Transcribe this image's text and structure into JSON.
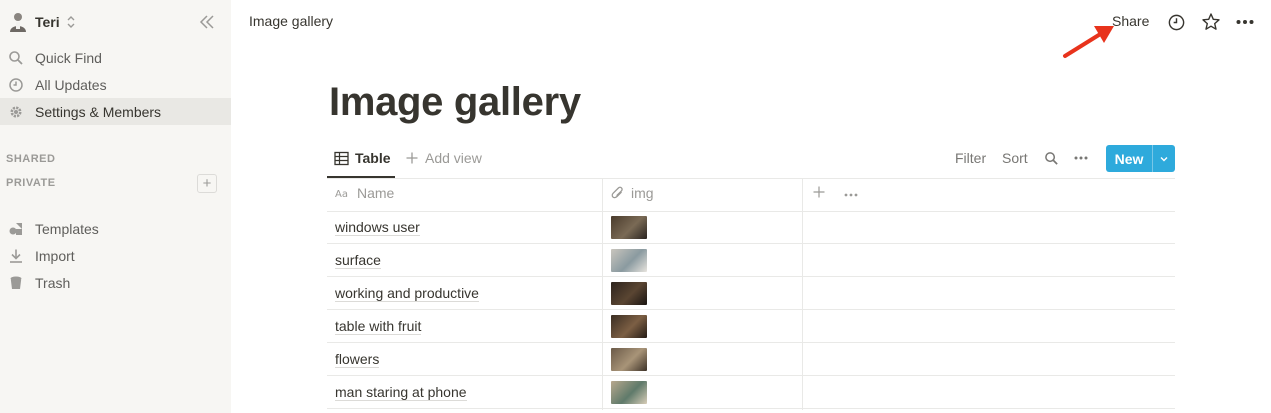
{
  "sidebar": {
    "workspace_name": "Teri",
    "nav": [
      {
        "label": "Quick Find",
        "icon": "search-icon"
      },
      {
        "label": "All Updates",
        "icon": "clock-icon"
      },
      {
        "label": "Settings & Members",
        "icon": "gear-icon"
      }
    ],
    "sections": {
      "shared": "SHARED",
      "private": "PRIVATE"
    },
    "footer": [
      {
        "label": "Templates",
        "icon": "shapes-icon"
      },
      {
        "label": "Import",
        "icon": "download-icon"
      },
      {
        "label": "Trash",
        "icon": "trash-icon"
      }
    ]
  },
  "topbar": {
    "breadcrumb": "Image gallery",
    "share_label": "Share",
    "icons": [
      "history-icon",
      "star-icon",
      "more-icon"
    ]
  },
  "page": {
    "title": "Image gallery",
    "view_tab": "Table",
    "add_view": "Add view",
    "filter": "Filter",
    "sort": "Sort",
    "new_label": "New"
  },
  "table": {
    "columns": [
      {
        "label": "Name",
        "icon": "text-type-icon"
      },
      {
        "label": "img",
        "icon": "paperclip-icon"
      }
    ],
    "rows": [
      {
        "name": "windows user",
        "thumb": [
          "#4a3b2c",
          "#7a6a55",
          "#2a2420"
        ]
      },
      {
        "name": "surface",
        "thumb": [
          "#c9c5bd",
          "#8a9aa0",
          "#e8e4de"
        ]
      },
      {
        "name": "working and productive",
        "thumb": [
          "#2d241d",
          "#5a4532",
          "#1a1512"
        ]
      },
      {
        "name": "table with fruit",
        "thumb": [
          "#3a2d22",
          "#7c5f44",
          "#241b15"
        ]
      },
      {
        "name": "flowers",
        "thumb": [
          "#6b5a48",
          "#a89478",
          "#3d3228"
        ]
      },
      {
        "name": "man staring at phone",
        "thumb": [
          "#b8a88e",
          "#5f7a6a",
          "#d8cdb8"
        ]
      }
    ]
  },
  "colors": {
    "accent": "#2eaadc",
    "annotation_arrow": "#e8331c",
    "sidebar_bg": "#f7f6f3"
  }
}
